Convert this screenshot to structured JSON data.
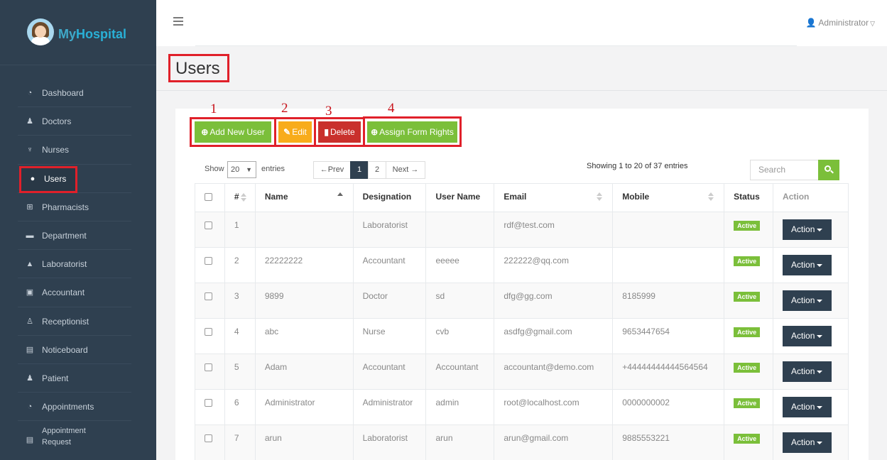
{
  "app": {
    "brand_prefix": "My",
    "brand_name": "Hospital"
  },
  "sidebar": {
    "items": [
      {
        "label": "Dashboard",
        "icon": "dashboard-icon"
      },
      {
        "label": "Doctors",
        "icon": "user-md-icon"
      },
      {
        "label": "Nurses",
        "icon": "stethoscope-icon"
      },
      {
        "label": "Users",
        "icon": "user-icon",
        "active": true
      },
      {
        "label": "Pharmacists",
        "icon": "plus-square-icon"
      },
      {
        "label": "Department",
        "icon": "briefcase-icon"
      },
      {
        "label": "Laboratorist",
        "icon": "flask-icon"
      },
      {
        "label": "Accountant",
        "icon": "money-icon"
      },
      {
        "label": "Receptionist",
        "icon": "child-icon"
      },
      {
        "label": "Noticeboard",
        "icon": "file-icon"
      },
      {
        "label": "Patient",
        "icon": "male-icon"
      },
      {
        "label": "Appointments",
        "icon": "dashboard-icon"
      },
      {
        "label": "Appointment",
        "label2": "Request",
        "icon": "list-alt-icon"
      }
    ]
  },
  "header": {
    "user": "Administrator"
  },
  "page": {
    "title": "Users"
  },
  "annotations": [
    "1",
    "2",
    "3",
    "4"
  ],
  "toolbar": {
    "add_label": "Add New User",
    "edit_label": "Edit",
    "delete_label": "Delete",
    "assign_label": "Assign Form Rights"
  },
  "table_controls": {
    "show_label": "Show",
    "page_size": "20",
    "entries_label": "entries",
    "prev_label": "←Prev",
    "pages": [
      "1",
      "2"
    ],
    "next_label": "Next →",
    "showing": "Showing 1 to 20 of 37 entries",
    "search_placeholder": "Search"
  },
  "table": {
    "columns": [
      "#",
      "Name",
      "Designation",
      "User Name",
      "Email",
      "Mobile",
      "Status",
      "Action"
    ],
    "rows": [
      {
        "num": "1",
        "name": "",
        "designation": "Laboratorist",
        "username": "",
        "email": "rdf@test.com",
        "mobile": "",
        "status": "Active",
        "action": "Action"
      },
      {
        "num": "2",
        "name": "22222222",
        "designation": "Accountant",
        "username": "eeeee",
        "email": "222222@qq.com",
        "mobile": "",
        "status": "Active",
        "action": "Action"
      },
      {
        "num": "3",
        "name": "9899",
        "designation": "Doctor",
        "username": "sd",
        "email": "dfg@gg.com",
        "mobile": "8185999",
        "status": "Active",
        "action": "Action"
      },
      {
        "num": "4",
        "name": "abc",
        "designation": "Nurse",
        "username": "cvb",
        "email": "asdfg@gmail.com",
        "mobile": "9653447654",
        "status": "Active",
        "action": "Action"
      },
      {
        "num": "5",
        "name": "Adam",
        "designation": "Accountant",
        "username": "Accountant",
        "email": "accountant@demo.com",
        "mobile": "+44444444444564564",
        "status": "Active",
        "action": "Action"
      },
      {
        "num": "6",
        "name": "Administrator",
        "designation": "Administrator",
        "username": "admin",
        "email": "root@localhost.com",
        "mobile": "0000000002",
        "status": "Active",
        "action": "Action"
      },
      {
        "num": "7",
        "name": "arun",
        "designation": "Laboratorist",
        "username": "arun",
        "email": "arun@gmail.com",
        "mobile": "9885553221",
        "status": "Active",
        "action": "Action"
      }
    ]
  },
  "colors": {
    "sidebar": "#2f4050",
    "green": "#7bbf3a",
    "yellow": "#f8ac1b",
    "red": "#c9302c",
    "highlight": "#e0202a"
  }
}
